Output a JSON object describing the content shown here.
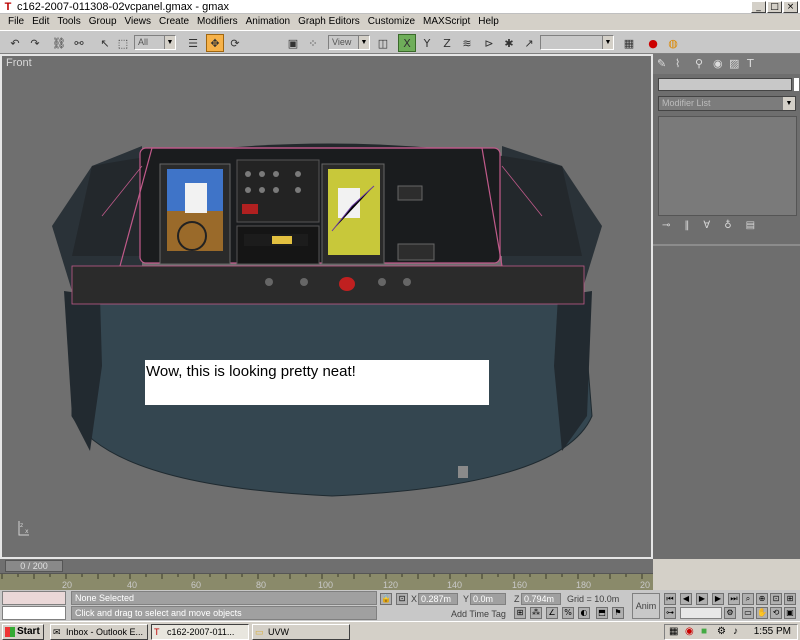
{
  "window": {
    "title": "c162-2007-011308-02vcpanel.gmax - gmax",
    "min": "_",
    "max": "□",
    "close": "×"
  },
  "menu": [
    "File",
    "Edit",
    "Tools",
    "Group",
    "Views",
    "Create",
    "Modifiers",
    "Animation",
    "Graph Editors",
    "Customize",
    "MAXScript",
    "Help"
  ],
  "toolbar": {
    "selection_filter": "All",
    "ref_coord": "View"
  },
  "viewport": {
    "label": "Front",
    "note": "Wow, this is looking pretty neat!"
  },
  "command_panel": {
    "modifier_list": "Modifier List"
  },
  "timeline": {
    "frame": "0 / 200",
    "ticks": [
      "20",
      "40",
      "60",
      "80",
      "100",
      "120",
      "140",
      "160",
      "180",
      "20"
    ]
  },
  "status": {
    "selection": "None Selected",
    "prompt": "Click and drag to select and move objects",
    "x": "0.287m",
    "y": "0.0m",
    "z": "0.794m",
    "grid": "Grid = 10.0m",
    "add_time_tag": "Add Time Tag",
    "anim": "Anim"
  },
  "taskbar": {
    "start": "Start",
    "tasks": [
      "Inbox - Outlook E...",
      "c162-2007-011...",
      "UVW"
    ],
    "clock": "1:55 PM"
  }
}
